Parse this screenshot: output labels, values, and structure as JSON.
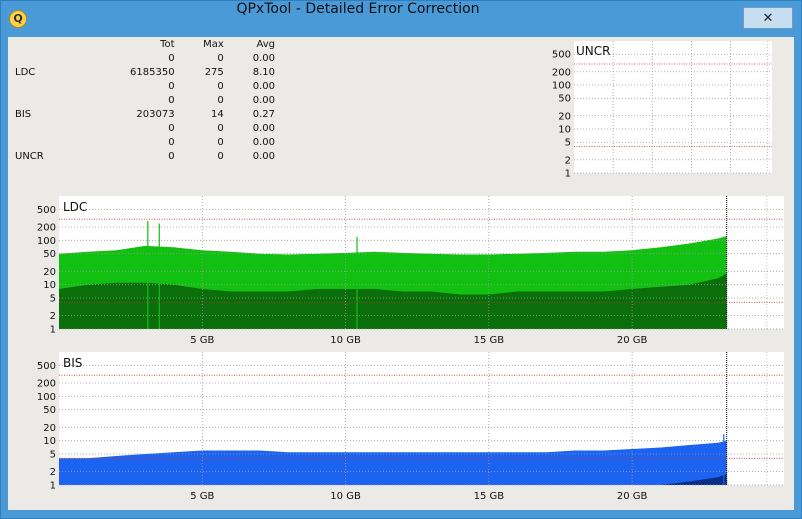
{
  "window": {
    "title": "QPxTool - Detailed Error Correction",
    "icon": "qpxtool-logo",
    "icon_glyph": "Q",
    "close_glyph": "✕"
  },
  "stats": {
    "headers": [
      "",
      "Tot",
      "Max",
      "Avg"
    ],
    "rows": [
      [
        "",
        "0",
        "0",
        "0.00"
      ],
      [
        "LDC",
        "6185350",
        "275",
        "8.10"
      ],
      [
        "",
        "0",
        "0",
        "0.00"
      ],
      [
        "",
        "0",
        "0",
        "0.00"
      ],
      [
        "BIS",
        "203073",
        "14",
        "0.27"
      ],
      [
        "",
        "0",
        "0",
        "0.00"
      ],
      [
        "",
        "0",
        "0",
        "0.00"
      ],
      [
        "UNCR",
        "0",
        "0",
        "0.00"
      ]
    ]
  },
  "charts": {
    "y_ticks": [
      "500",
      "200",
      "100",
      "50",
      "20",
      "10",
      "5",
      "2",
      "1"
    ],
    "x_ticks": [
      "5 GB",
      "10 GB",
      "15 GB",
      "20 GB"
    ],
    "uncr": {
      "title": "UNCR",
      "grid": true,
      "scale": "log"
    },
    "ldc": {
      "title": "LDC",
      "grid": true,
      "scale": "log",
      "colors": {
        "max": "#12c012",
        "avg": "#0a6e0a"
      }
    },
    "bis": {
      "title": "BIS",
      "grid": true,
      "scale": "log",
      "colors": {
        "max": "#1b63f0",
        "avg": "#0a2f86"
      }
    }
  },
  "chart_data": [
    {
      "type": "bar",
      "title": "UNCR",
      "x": [
        0,
        23.3
      ],
      "values": [
        0,
        0
      ],
      "xlim": [
        0,
        25.3
      ],
      "ylim": [
        1,
        1000
      ],
      "scale": "log",
      "x_ticks": [
        5,
        10,
        15,
        20
      ],
      "y_ticks": [
        1,
        2,
        5,
        10,
        20,
        50,
        100,
        200,
        500
      ]
    },
    {
      "type": "area",
      "title": "LDC",
      "xlim": [
        0,
        25.3
      ],
      "ylim": [
        1,
        1000
      ],
      "scale": "log",
      "x_ticks": [
        5,
        10,
        15,
        20
      ],
      "y_ticks": [
        1,
        2,
        5,
        10,
        20,
        50,
        100,
        200,
        500
      ],
      "x": [
        0,
        1,
        2,
        3,
        4,
        5,
        6,
        7,
        8,
        9,
        10,
        11,
        12,
        13,
        14,
        15,
        16,
        17,
        18,
        19,
        20,
        21,
        22,
        23,
        23.3
      ],
      "series": [
        {
          "values": [
            50,
            55,
            60,
            75,
            70,
            60,
            55,
            50,
            48,
            50,
            52,
            55,
            52,
            50,
            48,
            48,
            50,
            52,
            55,
            55,
            60,
            70,
            85,
            110,
            125
          ]
        },
        {
          "values": [
            8,
            10,
            11,
            11,
            10,
            8,
            7,
            7,
            7,
            8,
            8,
            8,
            7,
            7,
            6,
            6,
            7,
            7,
            7,
            7,
            8,
            9,
            10,
            14,
            18
          ]
        }
      ],
      "peaks": [
        [
          3.1,
          275
        ],
        [
          3.5,
          240
        ],
        [
          10.4,
          120
        ]
      ]
    },
    {
      "type": "area",
      "title": "BIS",
      "xlim": [
        0,
        25.3
      ],
      "ylim": [
        1,
        1000
      ],
      "scale": "log",
      "x_ticks": [
        5,
        10,
        15,
        20
      ],
      "y_ticks": [
        1,
        2,
        5,
        10,
        20,
        50,
        100,
        200,
        500
      ],
      "x": [
        0,
        1,
        2,
        3,
        4,
        5,
        6,
        7,
        8,
        9,
        10,
        11,
        12,
        13,
        14,
        15,
        16,
        17,
        18,
        19,
        20,
        21,
        22,
        23,
        23.3
      ],
      "series": [
        {
          "values": [
            4,
            4,
            4.5,
            5,
            5.5,
            6,
            6,
            6,
            5.5,
            5.5,
            5.5,
            5.5,
            5.5,
            5.5,
            5.5,
            5.5,
            5.5,
            5.5,
            6,
            6,
            6.5,
            7,
            8,
            9,
            10
          ]
        },
        {
          "values": [
            1,
            1,
            1,
            1,
            1,
            1,
            1,
            1,
            1,
            1,
            1,
            1,
            1,
            1,
            1,
            1,
            1,
            1,
            1,
            1,
            1,
            1,
            1.2,
            1.5,
            1.8
          ]
        }
      ],
      "peaks": [
        [
          23.2,
          14
        ]
      ]
    }
  ]
}
